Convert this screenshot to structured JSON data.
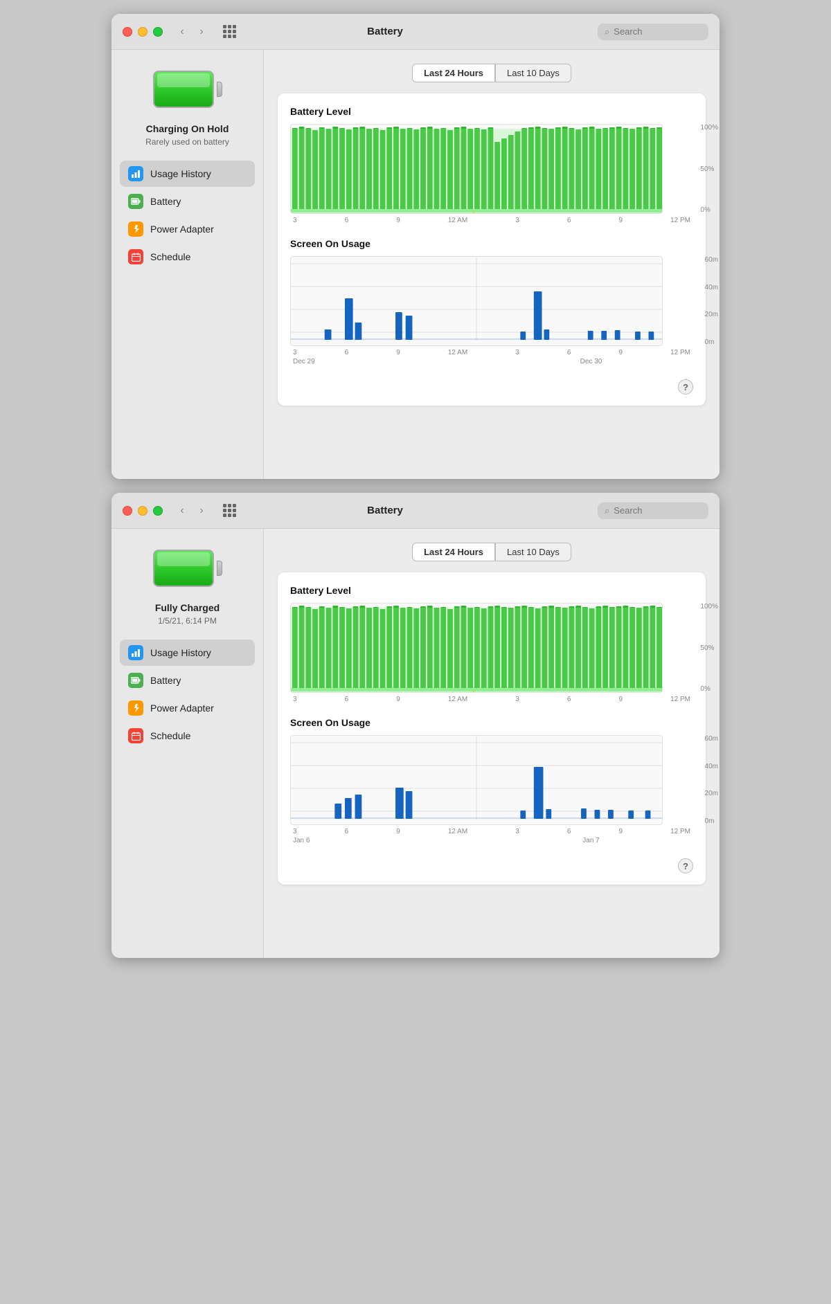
{
  "windows": [
    {
      "id": "window1",
      "title": "Battery",
      "search_placeholder": "Search",
      "battery_status": "Charging On Hold",
      "battery_sub": "Rarely used on battery",
      "tabs": [
        {
          "label": "Last 24 Hours",
          "active": true
        },
        {
          "label": "Last 10 Days",
          "active": false
        }
      ],
      "sidebar_items": [
        {
          "id": "usage-history",
          "label": "Usage History",
          "icon": "chart-icon",
          "icon_color": "blue",
          "active": true
        },
        {
          "id": "battery",
          "label": "Battery",
          "icon": "battery-icon",
          "icon_color": "green",
          "active": false
        },
        {
          "id": "power-adapter",
          "label": "Power Adapter",
          "icon": "power-icon",
          "icon_color": "orange",
          "active": false
        },
        {
          "id": "schedule",
          "label": "Schedule",
          "icon": "schedule-icon",
          "icon_color": "red",
          "active": false
        }
      ],
      "battery_chart": {
        "title": "Battery Level",
        "y_labels": [
          "100%",
          "50%",
          "0%"
        ],
        "x_labels": [
          "3",
          "6",
          "9",
          "12 AM",
          "3",
          "6",
          "9",
          "12 PM"
        ]
      },
      "screen_chart": {
        "title": "Screen On Usage",
        "y_labels": [
          "60m",
          "40m",
          "20m",
          "0m"
        ],
        "x_labels": [
          "3",
          "6",
          "9",
          "12 AM",
          "3",
          "6",
          "9",
          "12 PM"
        ],
        "date_labels": [
          "Dec 29",
          "Dec 30"
        ]
      }
    },
    {
      "id": "window2",
      "title": "Battery",
      "search_placeholder": "Search",
      "battery_status": "Fully Charged",
      "battery_sub": "1/5/21, 6:14 PM",
      "tabs": [
        {
          "label": "Last 24 Hours",
          "active": true
        },
        {
          "label": "Last 10 Days",
          "active": false
        }
      ],
      "sidebar_items": [
        {
          "id": "usage-history",
          "label": "Usage History",
          "icon": "chart-icon",
          "icon_color": "blue",
          "active": true
        },
        {
          "id": "battery",
          "label": "Battery",
          "icon": "battery-icon",
          "icon_color": "green",
          "active": false
        },
        {
          "id": "power-adapter",
          "label": "Power Adapter",
          "icon": "power-icon",
          "icon_color": "orange",
          "active": false
        },
        {
          "id": "schedule",
          "label": "Schedule",
          "icon": "schedule-icon",
          "icon_color": "red",
          "active": false
        }
      ],
      "battery_chart": {
        "title": "Battery Level",
        "y_labels": [
          "100%",
          "50%",
          "0%"
        ],
        "x_labels": [
          "3",
          "6",
          "9",
          "12 AM",
          "3",
          "6",
          "9",
          "12 PM"
        ]
      },
      "screen_chart": {
        "title": "Screen On Usage",
        "y_labels": [
          "60m",
          "40m",
          "20m",
          "0m"
        ],
        "x_labels": [
          "3",
          "6",
          "9",
          "12 AM",
          "3",
          "6",
          "9",
          "12 PM"
        ],
        "date_labels": [
          "Jan 6",
          "Jan 7"
        ]
      }
    }
  ]
}
